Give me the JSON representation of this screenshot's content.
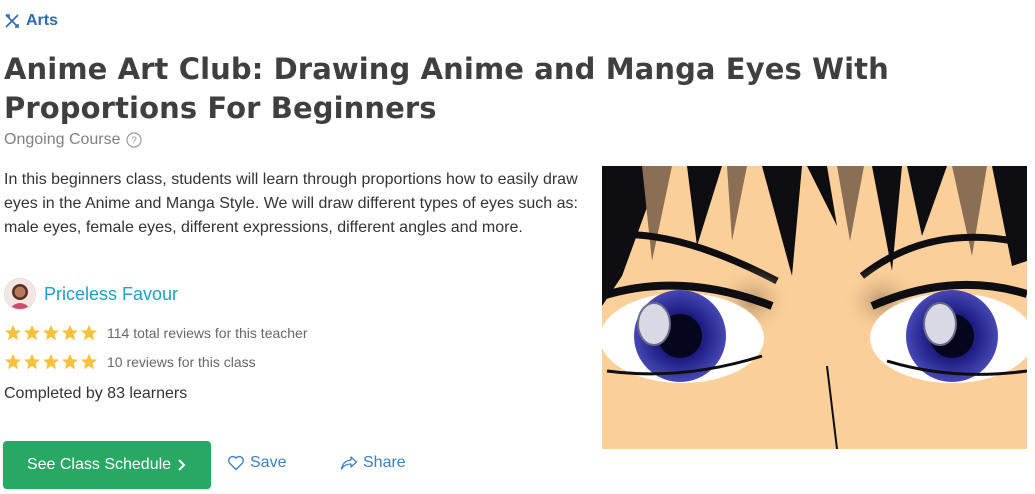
{
  "category": {
    "label": "Arts",
    "icon": "brush-ruler-icon"
  },
  "title": "Anime Art Club: Drawing Anime and Manga Eyes With Proportions For Beginners",
  "course_type": {
    "label": "Ongoing Course",
    "icon": "help-circle-icon"
  },
  "description": "In this beginners class, students will learn through proportions how to easily draw eyes in the Anime and Manga Style. We will draw different types of eyes such as: male eyes, female eyes, different expressions, different angles and more.",
  "teacher": {
    "name": "Priceless Favour",
    "avatar_icon": "teacher-avatar"
  },
  "ratings": {
    "teacher": {
      "stars": 5,
      "text": "114 total reviews for this teacher"
    },
    "class": {
      "stars": 5,
      "text": "10 reviews for this class"
    }
  },
  "completed": "Completed by 83 learners",
  "actions": {
    "schedule_label": "See Class Schedule",
    "save_label": "Save",
    "share_label": "Share"
  },
  "colors": {
    "accent_blue": "#2b6cb0",
    "teacher_link": "#1aa0c9",
    "button_green": "#27a865",
    "star_yellow": "#f6c23e",
    "link_blue": "#3a7fc4"
  },
  "image": {
    "subject": "anime-eyes-illustration"
  }
}
